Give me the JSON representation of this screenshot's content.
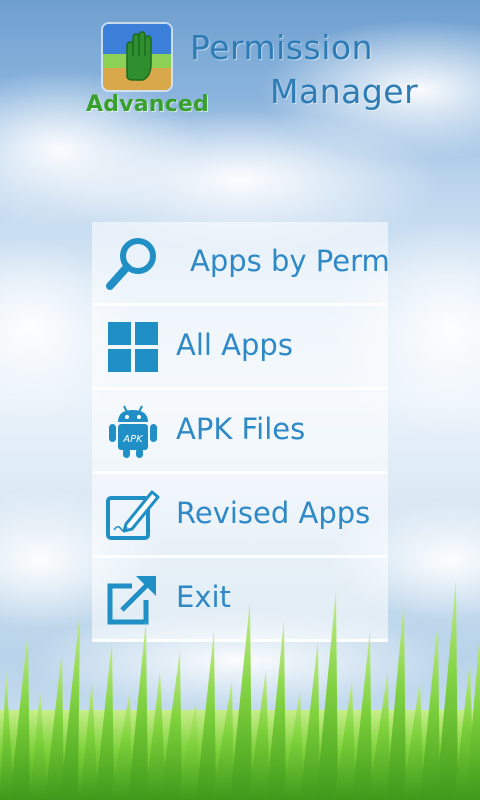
{
  "header": {
    "badge_text": "Advanced",
    "title_line1": "Permission",
    "title_line2": "Manager"
  },
  "menu": {
    "items": [
      {
        "label": "Apps by Permission",
        "icon": "magnifier-icon"
      },
      {
        "label": "All Apps",
        "icon": "grid-icon"
      },
      {
        "label": "APK Files",
        "icon": "android-apk-icon"
      },
      {
        "label": "Revised Apps",
        "icon": "edit-document-icon"
      },
      {
        "label": "Exit",
        "icon": "exit-arrow-icon"
      }
    ]
  },
  "colors": {
    "accent": "#1f8fc6",
    "label": "#2f89c7",
    "badge": "#39a02c"
  }
}
